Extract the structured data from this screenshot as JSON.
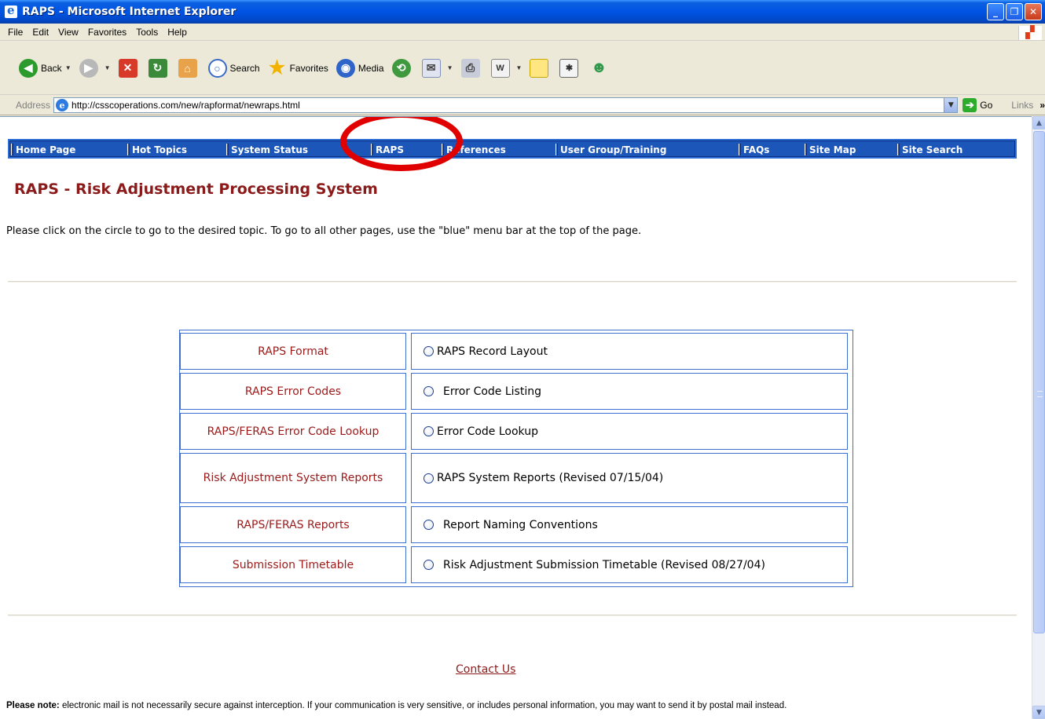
{
  "window": {
    "title": "RAPS - Microsoft Internet Explorer",
    "buttons": [
      "_",
      "❐",
      "✕"
    ]
  },
  "menu": [
    "File",
    "Edit",
    "View",
    "Favorites",
    "Tools",
    "Help"
  ],
  "toolbar": {
    "back": "Back",
    "search": "Search",
    "favorites": "Favorites",
    "media": "Media"
  },
  "address": {
    "label": "Address",
    "url": "http://csscoperations.com/new/rapformat/newraps.html",
    "go": "Go",
    "links": "Links"
  },
  "nav": [
    {
      "label": "Home Page"
    },
    {
      "label": "Hot Topics"
    },
    {
      "label": "System Status"
    },
    {
      "label": "RAPS"
    },
    {
      "label": "References"
    },
    {
      "label": "User Group/Training"
    },
    {
      "label": "FAQs"
    },
    {
      "label": "Site Map"
    },
    {
      "label": "Site Search"
    }
  ],
  "page": {
    "heading": "RAPS - Risk Adjustment Processing System",
    "intro": "Please click on the circle to go to the desired topic. To go to all other pages, use the \"blue\" menu bar at the top of the page."
  },
  "topics": [
    {
      "name": "RAPS Format",
      "option": "RAPS Record Layout"
    },
    {
      "name": "RAPS Error Codes",
      "option": "Error Code Listing"
    },
    {
      "name": "RAPS/FERAS Error Code Lookup",
      "option": "Error Code Lookup"
    },
    {
      "name": "Risk Adjustment System Reports",
      "option": "RAPS System Reports (Revised 07/15/04)"
    },
    {
      "name": "RAPS/FERAS Reports",
      "option": "Report Naming Conventions"
    },
    {
      "name": "Submission Timetable",
      "option": "Risk Adjustment Submission Timetable (Revised 08/27/04)"
    }
  ],
  "footer": {
    "contact": "Contact Us",
    "note_label": "Please note:",
    "note_text": " electronic mail is not necessarily secure against interception. If your communication is very sensitive, or includes personal information, you may want to send it by postal mail instead."
  },
  "colors": {
    "nav_bg": "#1b56b8",
    "heading": "#8b1a1a",
    "highlight_circle": "#e10000"
  }
}
